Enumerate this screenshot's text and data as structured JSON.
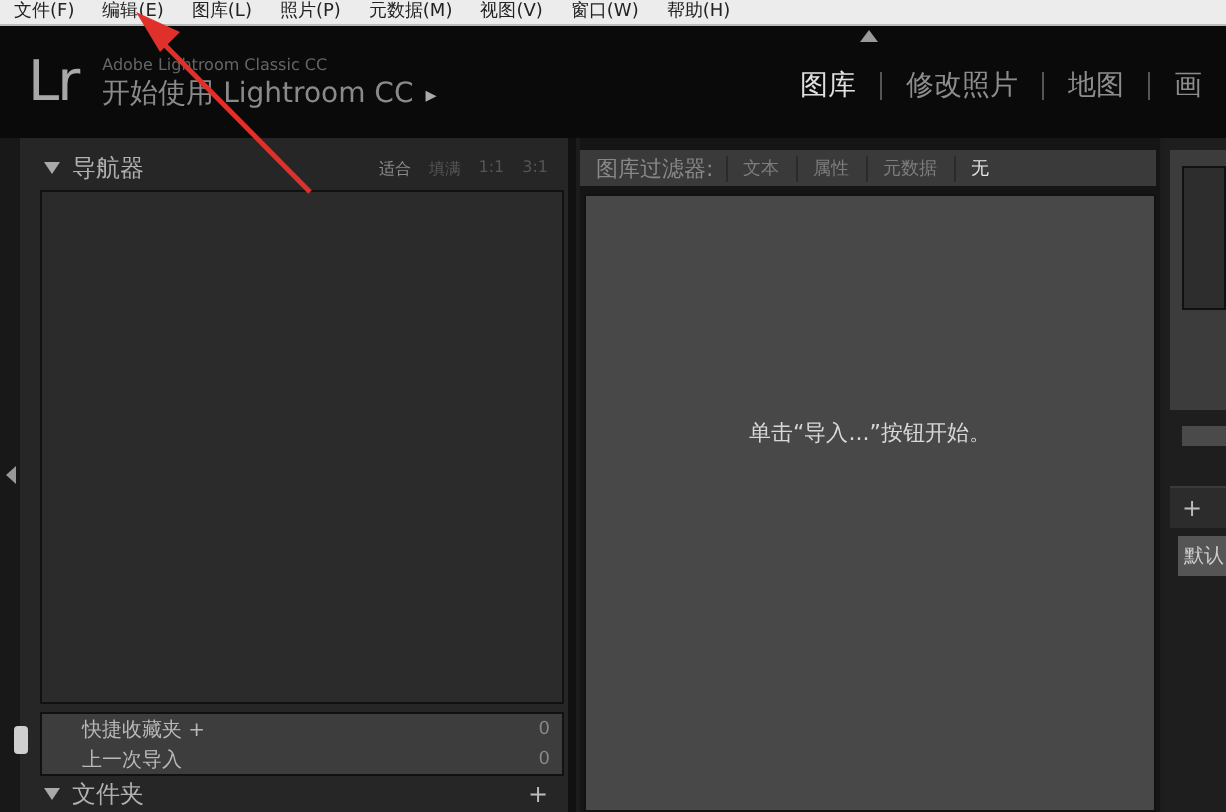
{
  "menu_bar": [
    "文件(F)",
    "编辑(E)",
    "图库(L)",
    "照片(P)",
    "元数据(M)",
    "视图(V)",
    "窗口(W)",
    "帮助(H)"
  ],
  "header": {
    "logo": "Lr",
    "product": "Adobe Lightroom Classic CC",
    "identity_plate": "开始使用 Lightroom CC",
    "identity_caret": "▸"
  },
  "modules": [
    {
      "label": "图库",
      "selected": true
    },
    {
      "label": "修改照片",
      "selected": false
    },
    {
      "label": "地图",
      "selected": false
    },
    {
      "label": "画",
      "selected": false
    }
  ],
  "left_panel": {
    "navigator": {
      "title": "导航器",
      "expanded": true,
      "zoom_options": [
        {
          "label": "适合",
          "selected": true
        },
        {
          "label": "填满",
          "selected": false
        },
        {
          "label": "1:1",
          "selected": false
        },
        {
          "label": "3:1",
          "selected": false
        }
      ]
    },
    "catalog_rows": [
      {
        "label": "快捷收藏夹 +",
        "count": "0"
      },
      {
        "label": "上一次导入",
        "count": "0"
      }
    ],
    "folders": {
      "title": "文件夹",
      "expanded": true,
      "add": "+"
    }
  },
  "library_filter": {
    "title": "图库过滤器:",
    "options": [
      {
        "label": "文本",
        "selected": false
      },
      {
        "label": "属性",
        "selected": false
      },
      {
        "label": "元数据",
        "selected": false
      },
      {
        "label": "无",
        "selected": true
      }
    ]
  },
  "grid": {
    "message": "单击“导入...”按钮开始。"
  },
  "right_panel": {
    "add": "+",
    "button": "默认"
  }
}
